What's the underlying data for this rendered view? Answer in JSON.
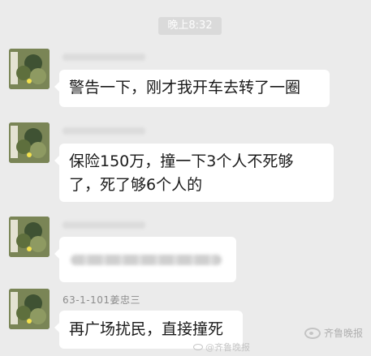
{
  "timestamp": "晚上8:32",
  "messages": [
    {
      "sender": "",
      "text": "警告一下，刚才我开车去转了一圈"
    },
    {
      "sender": "",
      "text": "保险150万，撞一下3个人不死够了，死了够6个人的"
    },
    {
      "sender": "",
      "text": ""
    },
    {
      "sender": "63-1-101姜忠三",
      "text": "再广场扰民，直接撞死"
    }
  ],
  "watermark": "齐鲁晚报",
  "weibo_watermark": "@齐鲁晚报",
  "colors": {
    "background": "#ebebeb",
    "bubble": "#ffffff",
    "timestamp_bg": "#dadada"
  }
}
